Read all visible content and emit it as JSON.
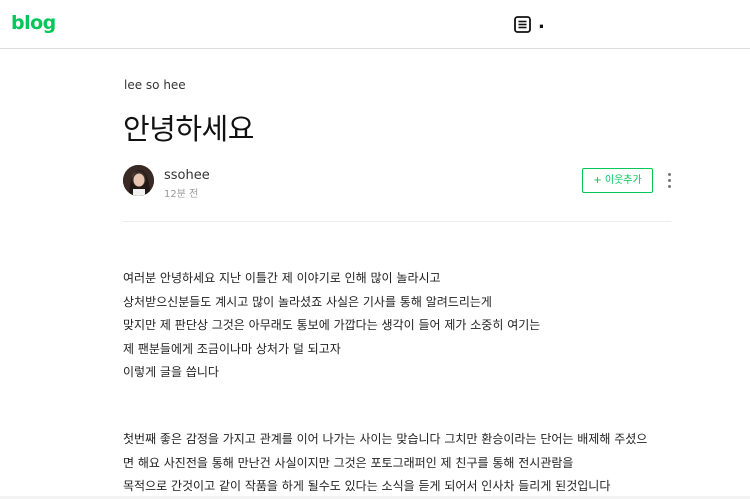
{
  "header": {
    "logo": "blog",
    "list_icon": "list-icon",
    "dot": "."
  },
  "post": {
    "category": "lee so hee",
    "title": "안녕하세요",
    "author": "ssohee",
    "time": "12분 전",
    "add_neighbor_label": "+ 이웃추가",
    "more_icon": "more-vertical-icon"
  },
  "content": {
    "paragraph1": [
      "여러분 안녕하세요 지난 이틀간 제 이야기로 인해 많이 놀라시고",
      "상처받으신분들도 계시고 많이 놀라셨죠 사실은 기사를 통해 알려드리는게",
      "맞지만 제 판단상 그것은 아무래도 통보에 가깝다는 생각이 들어 제가 소중히 여기는",
      "제 팬분들에게 조금이나마 상처가 덜 되고자",
      "이렇게 글을 씁니다"
    ],
    "paragraph2": [
      "첫번째 좋은 감정을 가지고 관계를 이어 나가는 사이는 맞습니다 그치만 환승이라는 단어는 배제해 주셨으",
      "면 해요 사진전을 통해 만난건 사실이지만 그것은 포토그래퍼인 제 친구를 통해 전시관람을",
      "목적으로 간것이고 같이 작품을 하게 될수도 있다는 소식을 듣게 되어서 인사차 들리게 된것입니다"
    ]
  },
  "colors": {
    "brand": "#03c75a"
  }
}
